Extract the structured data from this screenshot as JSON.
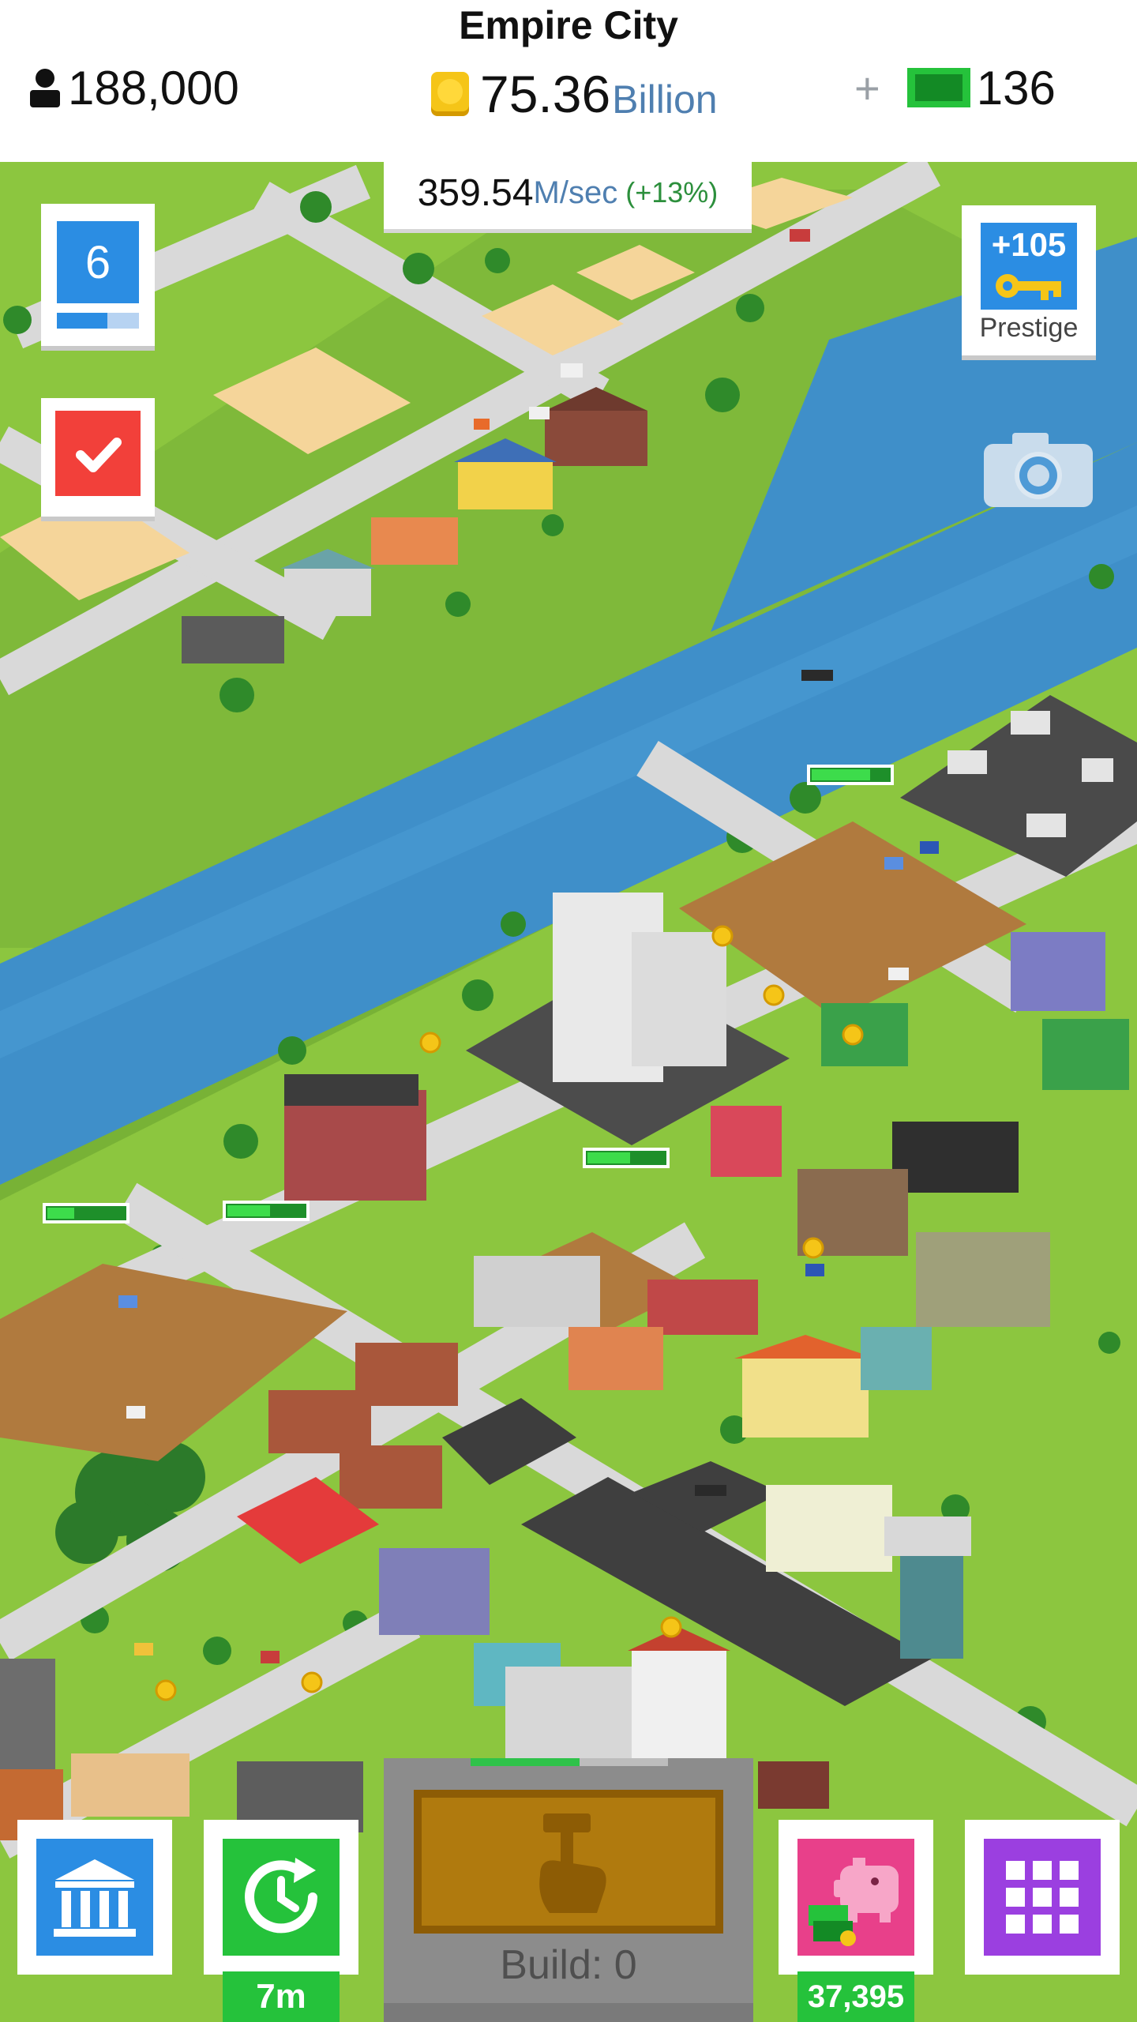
{
  "header": {
    "city_name": "Empire City",
    "population": "188,000",
    "money_value": "75.36",
    "money_unit": "Billion",
    "cash_plus": "+",
    "cash": "136"
  },
  "income": {
    "value": "359.54",
    "unit": "M/sec",
    "bonus": "(+13%)"
  },
  "level": {
    "number": "6",
    "progress": 0.62
  },
  "prestige": {
    "value": "+105",
    "label": "Prestige"
  },
  "bottom": {
    "boost_time": "7m",
    "piggy_amount": "37,395",
    "build_label": "Build: 0",
    "build_progress": 0.55
  },
  "icons": {
    "population": "person-icon",
    "money": "coin-icon",
    "cash": "cash-icon",
    "task": "checkmark-icon",
    "prestige": "key-icon",
    "camera": "camera-icon",
    "bank": "bank-icon",
    "boost": "clock-refresh-icon",
    "build": "hammer-hand-icon",
    "piggy": "piggy-bank-icon",
    "menu": "grid-menu-icon"
  },
  "colors": {
    "accent_blue": "#2b8de3",
    "boost_green": "#25c23b",
    "task_red": "#f2403a",
    "piggy_pink": "#e8408a",
    "menu_purple": "#9b3fe0"
  }
}
